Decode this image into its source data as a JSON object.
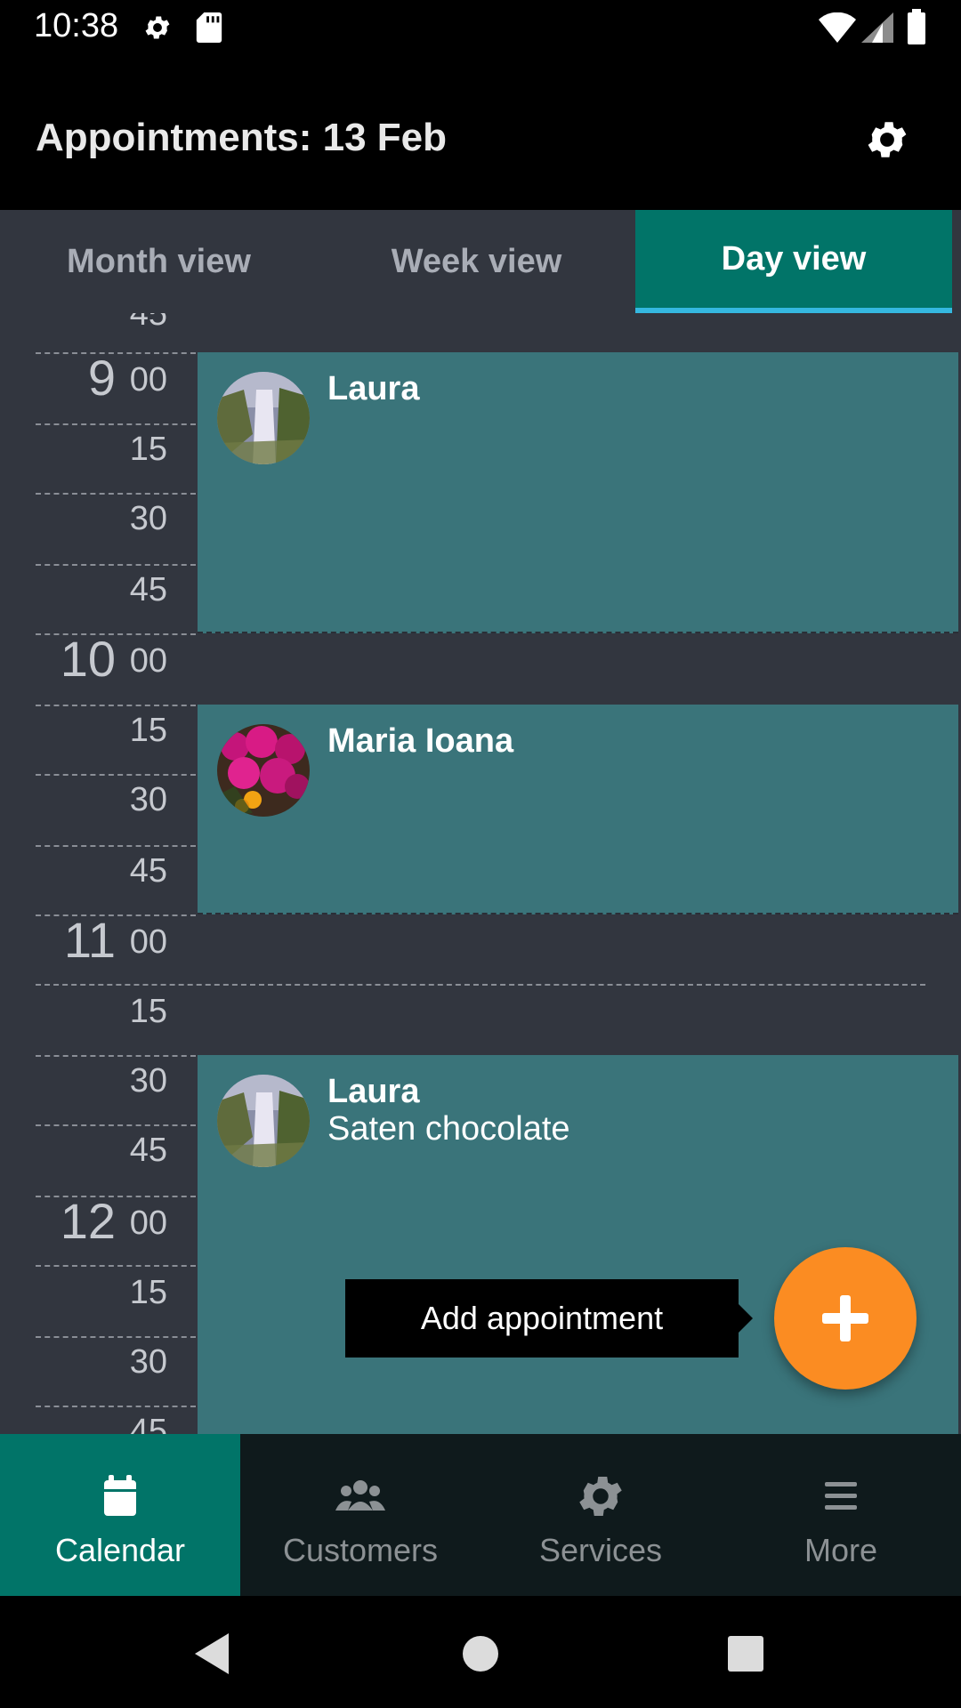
{
  "status_bar": {
    "time": "10:38"
  },
  "app_bar": {
    "title": "Appointments: 13 Feb"
  },
  "tabs": [
    {
      "label": "Month view",
      "selected": false
    },
    {
      "label": "Week view",
      "selected": false
    },
    {
      "label": "Day view",
      "selected": true
    }
  ],
  "schedule": {
    "hours": [
      "9",
      "10",
      "11",
      "12"
    ],
    "minutes": [
      "00",
      "15",
      "30",
      "45"
    ],
    "partial_top_label": "45",
    "partial_bottom_label": "45",
    "appointments": [
      {
        "customer": "Laura",
        "service": "",
        "avatar": "waterfall-photo"
      },
      {
        "customer": "Maria Ioana",
        "service": "",
        "avatar": "flowers-photo"
      },
      {
        "customer": "Laura",
        "service": "Saten chocolate",
        "avatar": "waterfall-photo"
      }
    ]
  },
  "fab": {
    "tooltip": "Add appointment",
    "icon": "plus-icon",
    "color": "#fb8c22"
  },
  "bottom_nav": [
    {
      "label": "Calendar",
      "icon": "calendar-icon",
      "active": true
    },
    {
      "label": "Customers",
      "icon": "people-icon",
      "active": false
    },
    {
      "label": "Services",
      "icon": "gear-icon",
      "active": false
    },
    {
      "label": "More",
      "icon": "menu-icon",
      "active": false
    }
  ],
  "colors": {
    "accent": "#017468",
    "appointment": "#3a747a",
    "tab_indicator": "#35b8e0",
    "background": "#32363f"
  }
}
